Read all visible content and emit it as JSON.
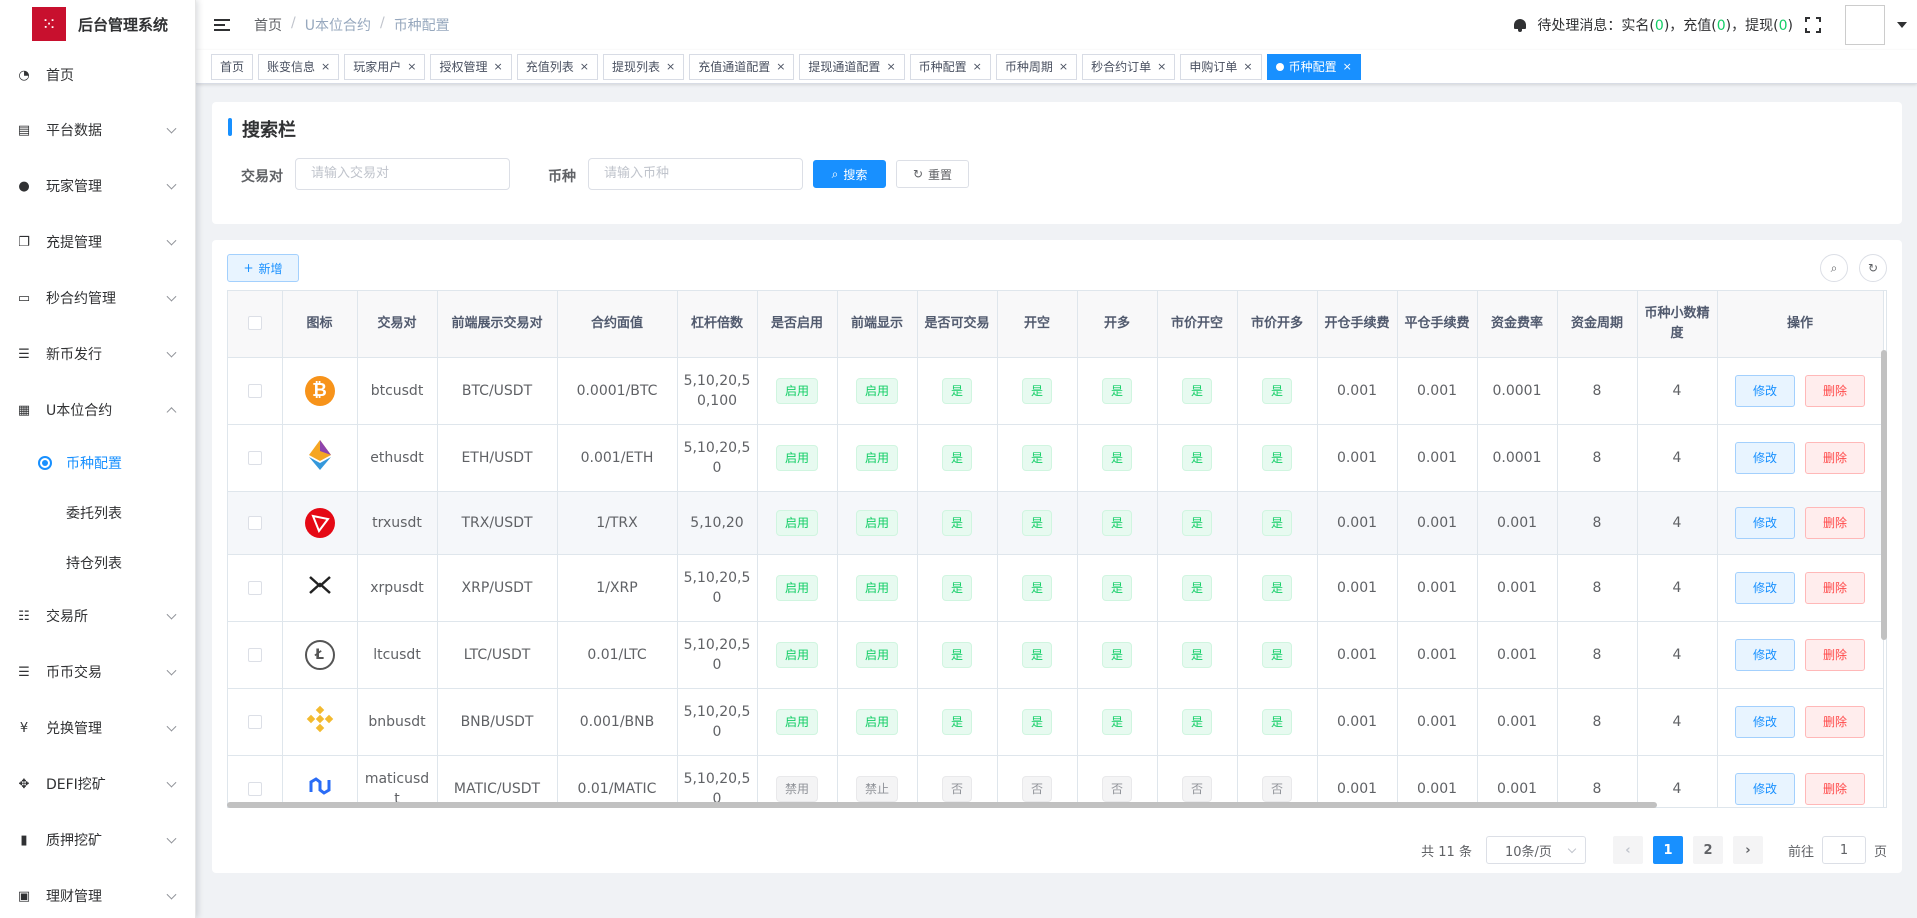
{
  "app": {
    "title": "后台管理系统"
  },
  "sidebar": {
    "items": [
      {
        "label": "首页",
        "icon": "dashboard-icon"
      },
      {
        "label": "平台数据",
        "icon": "chart-icon"
      },
      {
        "label": "玩家管理",
        "icon": "user-icon"
      },
      {
        "label": "充提管理",
        "icon": "documents-icon"
      },
      {
        "label": "秒合约管理",
        "icon": "monitor-icon"
      },
      {
        "label": "新币发行",
        "icon": "list-icon"
      },
      {
        "label": "U本位合约",
        "icon": "table-icon"
      }
    ],
    "sub_items": [
      {
        "label": "币种配置"
      },
      {
        "label": "委托列表"
      },
      {
        "label": "持仓列表"
      }
    ],
    "bottom_items": [
      {
        "label": "交易所",
        "icon": "tree-list-icon"
      },
      {
        "label": "币币交易",
        "icon": "list-icon"
      },
      {
        "label": "兑换管理",
        "icon": "yen-icon"
      },
      {
        "label": "DEFI挖矿",
        "icon": "drag-icon"
      },
      {
        "label": "质押挖矿",
        "icon": "bar-chart-icon"
      },
      {
        "label": "理财管理",
        "icon": "briefcase-icon"
      }
    ]
  },
  "header": {
    "breadcrumb": [
      "首页",
      "U本位合约",
      "币种配置"
    ],
    "notice_prefix": "待处理消息：实名(",
    "notice_realname": "0",
    "notice_mid1": ")，充值(",
    "notice_recharge": "0",
    "notice_mid2": ")，提现(",
    "notice_withdraw": "0",
    "notice_suffix": ")"
  },
  "tags": [
    {
      "label": "首页"
    },
    {
      "label": "账变信息"
    },
    {
      "label": "玩家用户"
    },
    {
      "label": "授权管理"
    },
    {
      "label": "充值列表"
    },
    {
      "label": "提现列表"
    },
    {
      "label": "充值通道配置"
    },
    {
      "label": "提现通道配置"
    },
    {
      "label": "币种配置"
    },
    {
      "label": "币种周期"
    },
    {
      "label": "秒合约订单"
    },
    {
      "label": "申购订单"
    },
    {
      "label": "币种配置"
    }
  ],
  "search": {
    "title": "搜索栏",
    "pair_label": "交易对",
    "pair_placeholder": "请输入交易对",
    "coin_label": "币种",
    "coin_placeholder": "请输入币种",
    "search_btn": "搜索",
    "reset_btn": "重置"
  },
  "toolbar": {
    "add_btn": "新增"
  },
  "table": {
    "columns": [
      "图标",
      "交易对",
      "前端展示交易对",
      "合约面值",
      "杠杆倍数",
      "是否启用",
      "前端显示",
      "是否可交易",
      "开空",
      "开多",
      "市价开空",
      "市价开多",
      "开仓手续费",
      "平仓手续费",
      "资金费率",
      "资金周期",
      "币种小数精度",
      "操作"
    ],
    "edit_label": "修改",
    "delete_label": "删除",
    "rows": [
      {
        "coin": "btc",
        "pair": "btcusdt",
        "display": "BTC/USDT",
        "face": "0.0001/BTC",
        "leverage": "5,10,20,50,100",
        "enabled": "启用",
        "front": "启用",
        "tradable": "是",
        "short": "是",
        "long": "是",
        "mkt_short": "是",
        "mkt_long": "是",
        "open_fee": "0.001",
        "close_fee": "0.001",
        "rate": "0.0001",
        "period": "8",
        "precision": "4",
        "active": true
      },
      {
        "coin": "eth",
        "pair": "ethusdt",
        "display": "ETH/USDT",
        "face": "0.001/ETH",
        "leverage": "5,10,20,50",
        "enabled": "启用",
        "front": "启用",
        "tradable": "是",
        "short": "是",
        "long": "是",
        "mkt_short": "是",
        "mkt_long": "是",
        "open_fee": "0.001",
        "close_fee": "0.001",
        "rate": "0.0001",
        "period": "8",
        "precision": "4",
        "active": true
      },
      {
        "coin": "trx",
        "pair": "trxusdt",
        "display": "TRX/USDT",
        "face": "1/TRX",
        "leverage": "5,10,20",
        "enabled": "启用",
        "front": "启用",
        "tradable": "是",
        "short": "是",
        "long": "是",
        "mkt_short": "是",
        "mkt_long": "是",
        "open_fee": "0.001",
        "close_fee": "0.001",
        "rate": "0.001",
        "period": "8",
        "precision": "4",
        "active": true
      },
      {
        "coin": "xrp",
        "pair": "xrpusdt",
        "display": "XRP/USDT",
        "face": "1/XRP",
        "leverage": "5,10,20,50",
        "enabled": "启用",
        "front": "启用",
        "tradable": "是",
        "short": "是",
        "long": "是",
        "mkt_short": "是",
        "mkt_long": "是",
        "open_fee": "0.001",
        "close_fee": "0.001",
        "rate": "0.001",
        "period": "8",
        "precision": "4",
        "active": true
      },
      {
        "coin": "ltc",
        "pair": "ltcusdt",
        "display": "LTC/USDT",
        "face": "0.01/LTC",
        "leverage": "5,10,20,50",
        "enabled": "启用",
        "front": "启用",
        "tradable": "是",
        "short": "是",
        "long": "是",
        "mkt_short": "是",
        "mkt_long": "是",
        "open_fee": "0.001",
        "close_fee": "0.001",
        "rate": "0.001",
        "period": "8",
        "precision": "4",
        "active": true
      },
      {
        "coin": "bnb",
        "pair": "bnbusdt",
        "display": "BNB/USDT",
        "face": "0.001/BNB",
        "leverage": "5,10,20,50",
        "enabled": "启用",
        "front": "启用",
        "tradable": "是",
        "short": "是",
        "long": "是",
        "mkt_short": "是",
        "mkt_long": "是",
        "open_fee": "0.001",
        "close_fee": "0.001",
        "rate": "0.001",
        "period": "8",
        "precision": "4",
        "active": true
      },
      {
        "coin": "matic",
        "pair": "maticusdt",
        "display": "MATIC/USDT",
        "face": "0.01/MATIC",
        "leverage": "5,10,20,50",
        "enabled": "禁用",
        "front": "禁止",
        "tradable": "否",
        "short": "否",
        "long": "否",
        "mkt_short": "否",
        "mkt_long": "否",
        "open_fee": "0.001",
        "close_fee": "0.001",
        "rate": "0.001",
        "period": "8",
        "precision": "4",
        "active": false
      }
    ]
  },
  "pagination": {
    "total_prefix": "共 11 条",
    "page_size": "10条/页",
    "pages": [
      "1",
      "2"
    ],
    "current": "1",
    "goto_prefix": "前往",
    "goto_value": "1",
    "goto_suffix": "页"
  },
  "colors": {
    "primary": "#1890ff",
    "success": "#13ce66",
    "danger": "#ff4949",
    "brand": "#c8102e"
  }
}
